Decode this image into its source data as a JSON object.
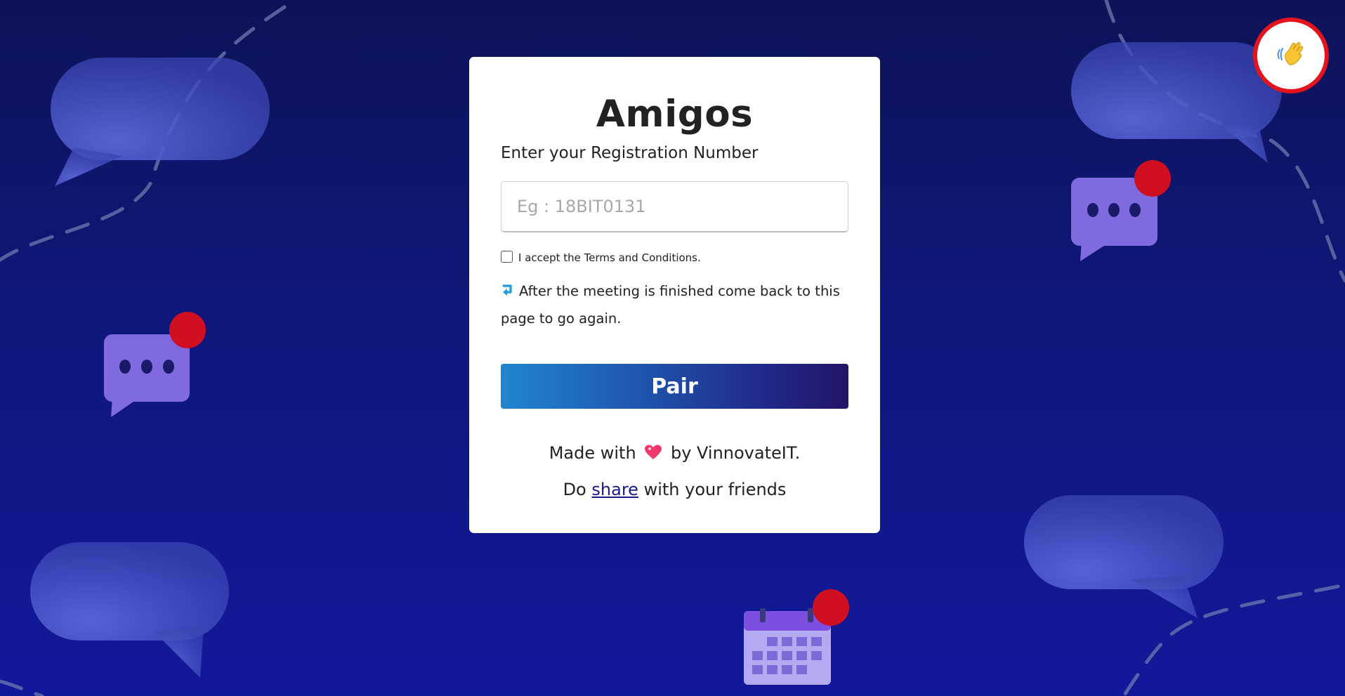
{
  "app": {
    "title": "Amigos",
    "subtitle": "Enter your Registration Number"
  },
  "form": {
    "reg_placeholder": "Eg : 18BIT0131",
    "reg_value": "",
    "terms_label": "I accept the Terms and Conditions.",
    "terms_checked": false,
    "note": "After the meeting is finished come back to this page to go again.",
    "note_icon": "return-arrow-icon",
    "pair_label": "Pair"
  },
  "footer": {
    "made_with_prefix": "Made with",
    "made_with_icon": "heart-icon",
    "made_with_suffix": "by VinnovateIT.",
    "share_prefix": "Do",
    "share_link": "share",
    "share_suffix": "with your friends"
  },
  "wave_button": {
    "icon": "waving-hand-icon"
  },
  "colors": {
    "background_top": "#0d1358",
    "background_bottom": "#12189a",
    "accent_red": "#e3141b",
    "bubble_purple": "#7f6ae0",
    "button_gradient_start": "#2186cf",
    "button_gradient_end": "#221467"
  }
}
